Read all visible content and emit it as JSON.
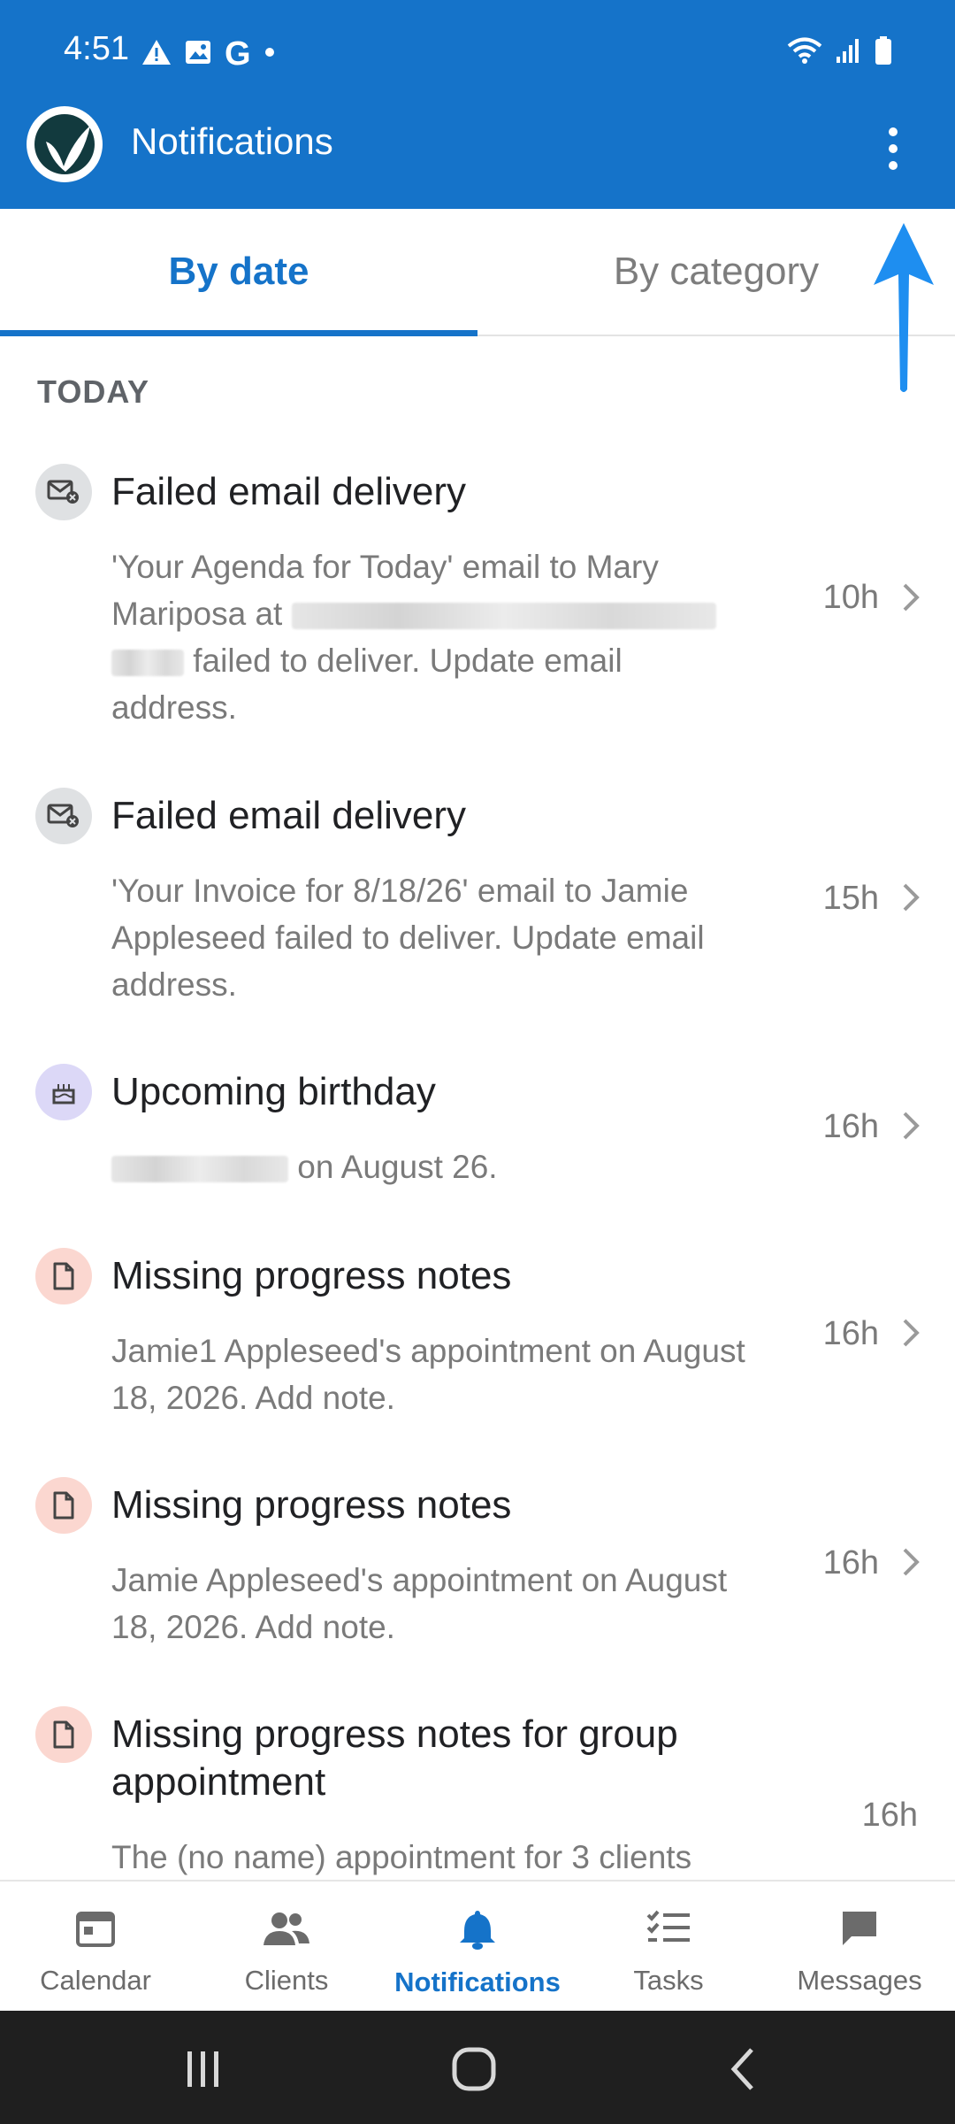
{
  "status_bar": {
    "time": "4:51",
    "left_icons": [
      "warning-icon",
      "image-icon",
      "google-icon",
      "dot-icon"
    ],
    "right_icons": [
      "wifi-icon",
      "signal-icon",
      "battery-icon"
    ]
  },
  "app_bar": {
    "title": "Notifications",
    "logo_icon": "app-logo-icon",
    "menu_icon": "more-vert-icon"
  },
  "tabs": [
    {
      "label": "By date",
      "active": true
    },
    {
      "label": "By category",
      "active": false
    }
  ],
  "section": {
    "label": "TODAY"
  },
  "notifications": [
    {
      "icon": "failed-email-icon",
      "title": "Failed email delivery",
      "body_line1": "'Your Agenda for Today' email to Mary",
      "body_line2_prefix": "Mariposa at",
      "body_line3_suffix": "failed to deliver. Update email",
      "body_line4": "address.",
      "time": "10h"
    },
    {
      "icon": "failed-email-icon",
      "title": "Failed email delivery",
      "body": "'Your Invoice for 8/18/26' email to Jamie Appleseed failed to deliver. Update email address.",
      "time": "15h"
    },
    {
      "icon": "birthday-cake-icon",
      "title": "Upcoming birthday",
      "body_suffix": "on August 26.",
      "time": "16h"
    },
    {
      "icon": "document-icon",
      "title": "Missing progress notes",
      "body": "Jamie1 Appleseed's appointment on August 18, 2026. Add note.",
      "time": "16h"
    },
    {
      "icon": "document-icon",
      "title": "Missing progress notes",
      "body": "Jamie Appleseed's appointment on August 18, 2026. Add note.",
      "time": "16h"
    },
    {
      "icon": "document-icon",
      "title": "Missing progress notes for group appointment",
      "body": "The (no name) appointment for 3 clients",
      "time": "16h"
    }
  ],
  "bottom_nav": [
    {
      "label": "Calendar",
      "icon": "calendar-icon",
      "active": false
    },
    {
      "label": "Clients",
      "icon": "clients-icon",
      "active": false
    },
    {
      "label": "Notifications",
      "icon": "bell-icon",
      "active": true
    },
    {
      "label": "Tasks",
      "icon": "tasks-icon",
      "active": false
    },
    {
      "label": "Messages",
      "icon": "messages-icon",
      "active": false
    }
  ],
  "system_nav": [
    "recents-icon",
    "home-icon",
    "back-icon"
  ],
  "colors": {
    "primary": "#1573c9",
    "annotation_arrow": "#1e8ef0",
    "email_icon_bg": "#dfe1e3",
    "birthday_icon_bg": "#dcd8f7",
    "document_icon_bg": "#fbd7d0"
  }
}
